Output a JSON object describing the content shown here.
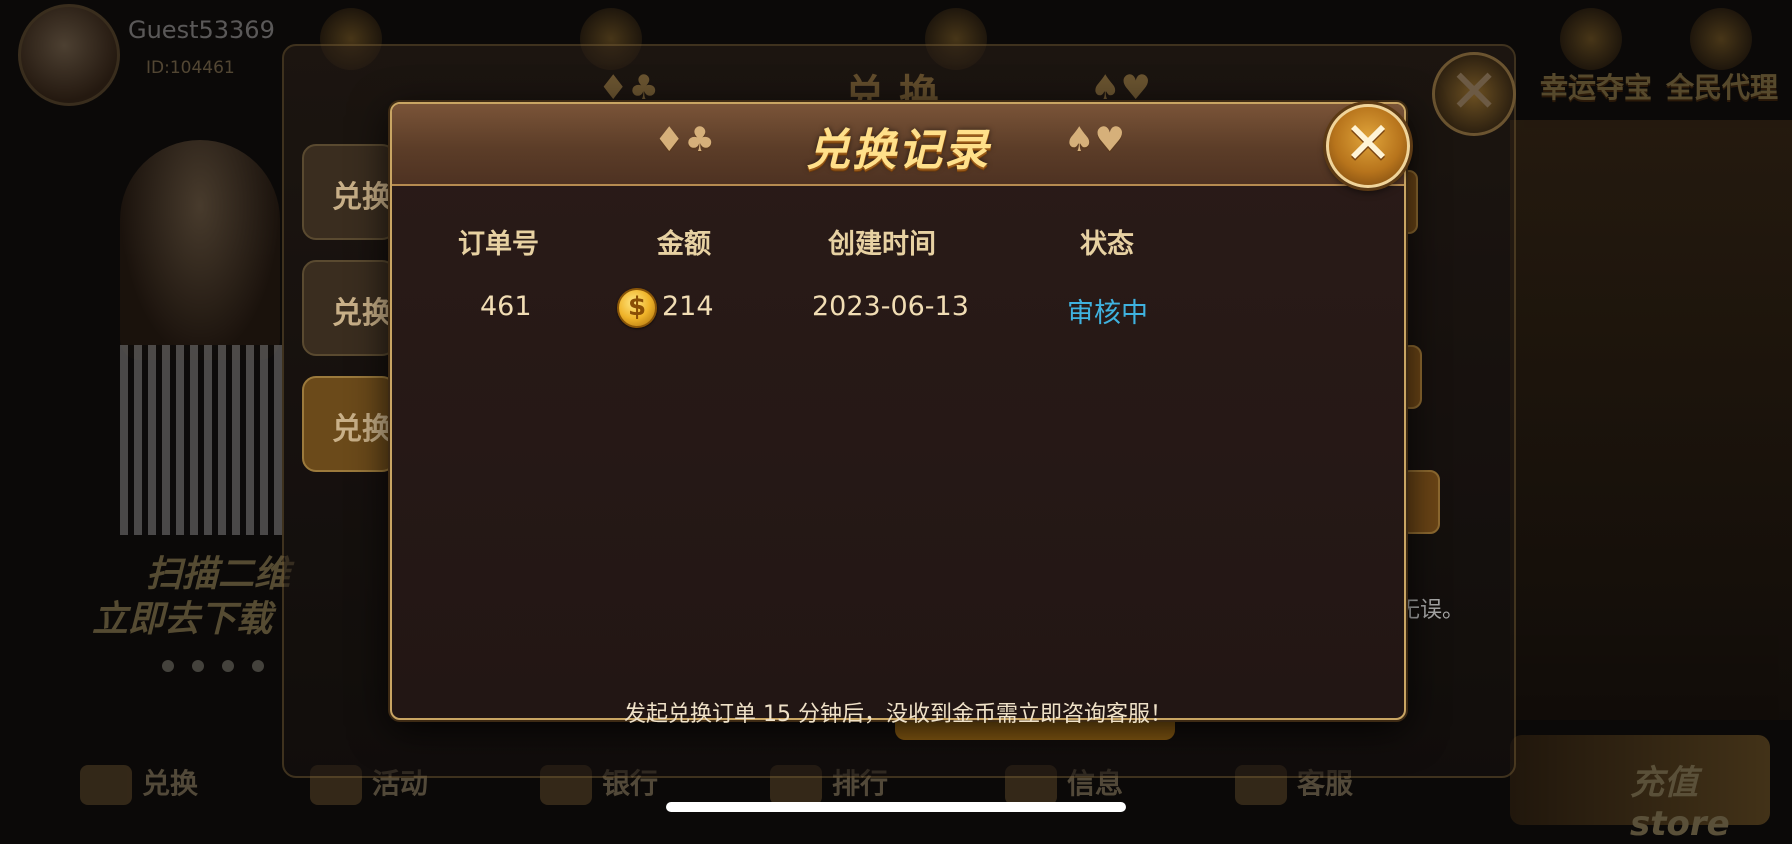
{
  "background": {
    "player": {
      "name": "Guest53369",
      "id": "ID:104461"
    },
    "panel_title": "兑换",
    "tabs": [
      "兑换",
      "兑换",
      "兑换"
    ],
    "qr_text_line1": "扫描二维",
    "qr_text_line2": "立即去下载",
    "right_labels": [
      "幸运夺宝",
      "全民代理"
    ],
    "note_fragment": "无误。",
    "bottom_nav": [
      "兑换",
      "活动",
      "银行",
      "排行",
      "信息",
      "客服"
    ],
    "store_label": "充值 store"
  },
  "dialog": {
    "title": "兑换记录",
    "suits_left": "♦♣",
    "suits_right": "♠♥",
    "close_symbol": "✕",
    "columns": [
      "订单号",
      "金额",
      "创建时间",
      "状态"
    ],
    "rows": [
      {
        "order_no": "461",
        "amount": "214",
        "created": "2023-06-13",
        "status": "审核中"
      }
    ],
    "coin_icon": "dollar-coin-icon",
    "footer_note": "发起兑换订单 15 分钟后，没收到金币需立即咨询客服！",
    "status_color": "#3fb2df",
    "title_color": "#ffe08a"
  }
}
